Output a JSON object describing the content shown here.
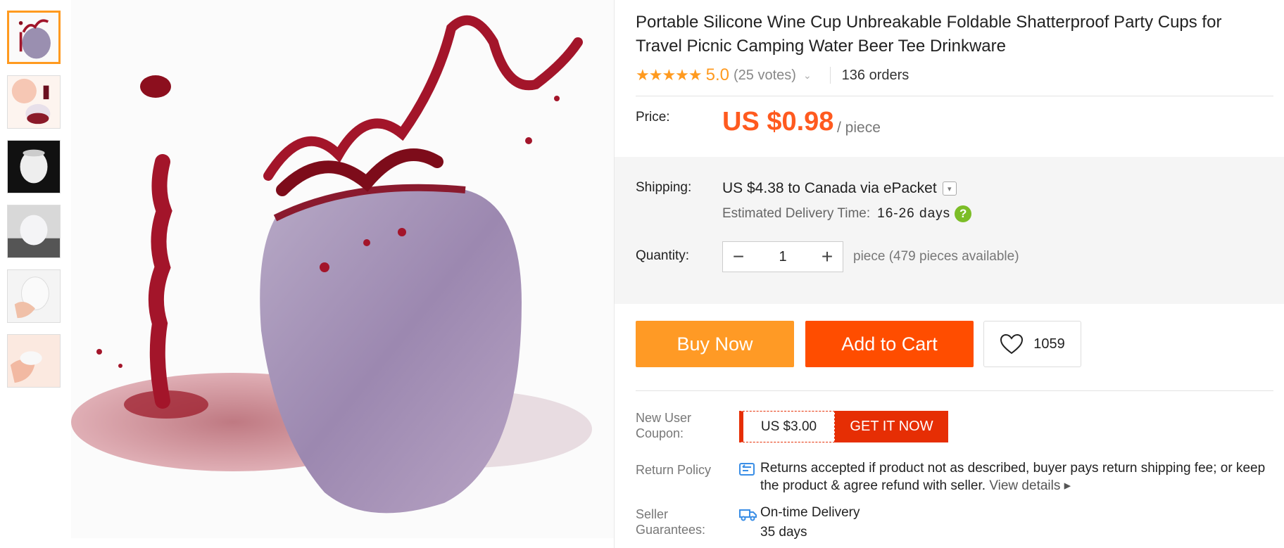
{
  "product": {
    "title": "Portable Silicone Wine Cup Unbreakable Foldable Shatterproof Party Cups for Travel Picnic Camping Water Beer Tee Drinkware",
    "stars": "★★★★★",
    "rating": "5.0",
    "votes": "(25 votes)",
    "orders": "136 orders"
  },
  "price": {
    "label": "Price:",
    "value": "US $0.98",
    "unit": "/ piece"
  },
  "shipping": {
    "label": "Shipping:",
    "value": "US $4.38 to Canada via ePacket",
    "delivery_label": "Estimated Delivery Time:",
    "delivery_days": "16-26 days"
  },
  "quantity": {
    "label": "Quantity:",
    "value": "1",
    "available": "piece (479 pieces available)"
  },
  "actions": {
    "buy_now": "Buy Now",
    "add_to_cart": "Add to Cart",
    "wishlist_count": "1059"
  },
  "coupon": {
    "label": "New User Coupon:",
    "amount": "US $3.00",
    "cta": "GET IT NOW"
  },
  "return_policy": {
    "label": "Return Policy",
    "text": "Returns accepted if product not as described, buyer pays return shipping fee; or keep the product & agree refund with seller.",
    "link": "View details"
  },
  "seller": {
    "label": "Seller Guarantees:",
    "delivery": "On-time Delivery",
    "days": "35 days"
  },
  "colors": {
    "accent_orange": "#ff9a25",
    "cart_red": "#ff4d00",
    "price_orange": "#ff5a1f",
    "coupon_red": "#e62e04"
  },
  "icons": [
    "chevron-down-icon",
    "help-icon",
    "minus-icon",
    "plus-icon",
    "heart-icon",
    "return-icon",
    "truck-icon"
  ]
}
